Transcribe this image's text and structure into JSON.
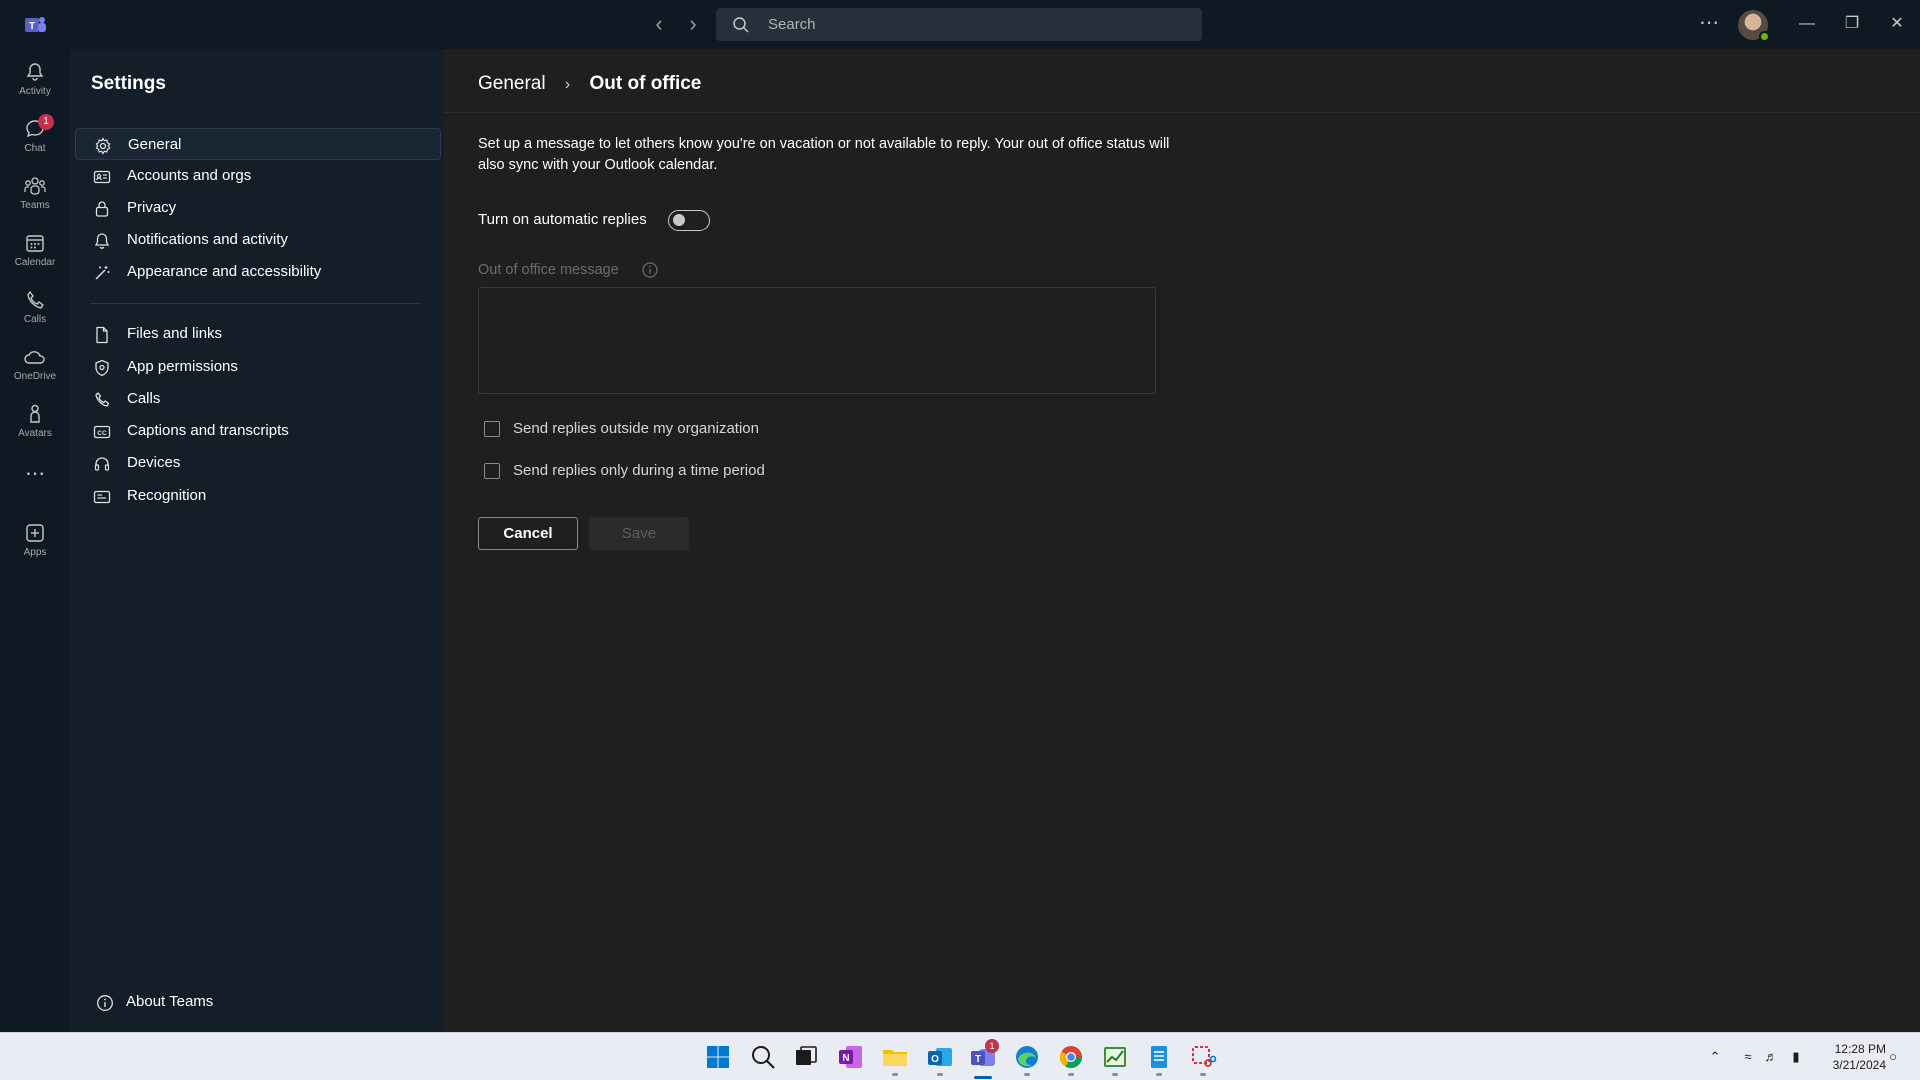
{
  "titlebar": {
    "search_placeholder": "Search",
    "more_label": "⋯"
  },
  "rail": {
    "items": [
      {
        "label": "Activity"
      },
      {
        "label": "Chat",
        "badge": "1"
      },
      {
        "label": "Teams"
      },
      {
        "label": "Calendar"
      },
      {
        "label": "Calls"
      },
      {
        "label": "OneDrive"
      },
      {
        "label": "Avatars"
      },
      {
        "label": "Apps"
      }
    ],
    "more_label": "⋯"
  },
  "settings": {
    "title": "Settings",
    "group1": [
      {
        "label": "General",
        "icon": "gear-icon",
        "active": true
      },
      {
        "label": "Accounts and orgs",
        "icon": "id-card-icon"
      },
      {
        "label": "Privacy",
        "icon": "lock-icon"
      },
      {
        "label": "Notifications and activity",
        "icon": "bell-icon"
      },
      {
        "label": "Appearance and accessibility",
        "icon": "magic-wand-icon"
      }
    ],
    "group2": [
      {
        "label": "Files and links",
        "icon": "file-icon"
      },
      {
        "label": "App permissions",
        "icon": "shield-icon"
      },
      {
        "label": "Calls",
        "icon": "phone-icon"
      },
      {
        "label": "Captions and transcripts",
        "icon": "closed-captions-icon"
      },
      {
        "label": "Devices",
        "icon": "headset-icon"
      },
      {
        "label": "Recognition",
        "icon": "recognition-icon"
      }
    ],
    "about_label": "About Teams"
  },
  "main": {
    "breadcrumb": {
      "parent": "General",
      "separator": "›",
      "current": "Out of office"
    },
    "description": "Set up a message to let others know you're on vacation or not available to reply. Your out of office status will also sync with your Outlook calendar.",
    "auto_replies_label": "Turn on automatic replies",
    "auto_replies_on": false,
    "message_label": "Out of office message",
    "message_value": "",
    "checkbox_outside_label": "Send replies outside my organization",
    "checkbox_outside_checked": false,
    "checkbox_time_label": "Send replies only during a time period",
    "checkbox_time_checked": false,
    "cancel_label": "Cancel",
    "save_label": "Save"
  },
  "taskbar": {
    "teams_badge": "1",
    "time": "12:28 PM",
    "date": "3/21/2024"
  },
  "colors": {
    "rail_bg": "#0f1923",
    "pane_bg": "#141e29",
    "main_bg": "#1f1f1f",
    "badge": "#c4314b",
    "presence": "#6bb700",
    "taskbar_bg": "#e9edf3"
  }
}
